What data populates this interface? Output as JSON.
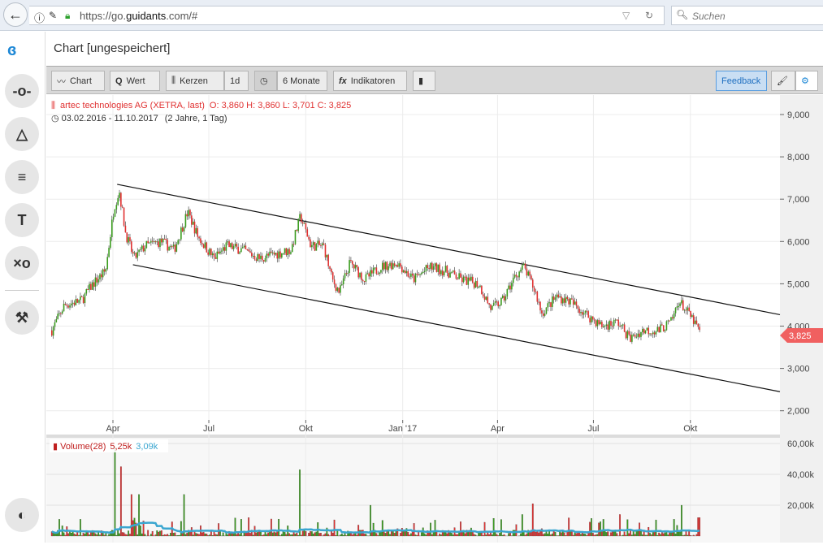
{
  "browser": {
    "url_prefix": "https://go.",
    "url_domain": "guidants",
    "url_suffix": ".com/#",
    "search_placeholder": "Suchen"
  },
  "page": {
    "title": "Chart [ungespeichert]"
  },
  "toolbar": {
    "chart": "Chart",
    "wert": "Wert",
    "kerzen": "Kerzen",
    "interval": "1d",
    "range": "6 Monate",
    "indikatoren": "Indikatoren",
    "feedback": "Feedback"
  },
  "colors": {
    "up": "#3a9c1e",
    "down": "#e03131",
    "accent": "#1e88d6",
    "volume_ma": "#3aa6d0",
    "last_price": "#f06060"
  },
  "chart_data": {
    "type": "candlestick",
    "instrument": "artec technologies AG (XETRA, last)",
    "ohlc_label": {
      "O": "3,860",
      "H": "3,860",
      "L": "3,701",
      "C": "3,825"
    },
    "ohlc_text": "O: 3,860  H: 3,860  L: 3,701  C: 3,825",
    "range_text": "03.02.2016 - 11.10.2017",
    "range_extra": "(2 Jahre, 1 Tag)",
    "last_price": "3,825",
    "y_ticks": [
      "9,000",
      "8,000",
      "7,000",
      "6,000",
      "5,000",
      "4,000",
      "3,000",
      "2,000"
    ],
    "ylim": [
      1800,
      9250
    ],
    "x_ticks": [
      {
        "label": "Apr",
        "date": "2016-04-01"
      },
      {
        "label": "Jul",
        "date": "2016-07-01"
      },
      {
        "label": "Okt",
        "date": "2016-10-01"
      },
      {
        "label": "Jan '17",
        "date": "2017-01-01"
      },
      {
        "label": "Apr",
        "date": "2017-04-01"
      },
      {
        "label": "Jul",
        "date": "2017-07-01"
      },
      {
        "label": "Okt",
        "date": "2017-10-01"
      }
    ],
    "closes": [
      [
        "2016-02-03",
        3.9
      ],
      [
        "2016-02-15",
        4.5
      ],
      [
        "2016-03-02",
        4.6
      ],
      [
        "2016-03-13",
        5.0
      ],
      [
        "2016-03-25",
        5.3
      ],
      [
        "2016-04-02",
        6.8
      ],
      [
        "2016-04-07",
        7.2
      ],
      [
        "2016-04-13",
        6.2
      ],
      [
        "2016-04-21",
        5.6
      ],
      [
        "2016-05-02",
        5.9
      ],
      [
        "2016-05-17",
        6.0
      ],
      [
        "2016-05-29",
        5.8
      ],
      [
        "2016-06-11",
        6.7
      ],
      [
        "2016-06-21",
        6.1
      ],
      [
        "2016-07-06",
        5.6
      ],
      [
        "2016-07-18",
        5.9
      ],
      [
        "2016-08-02",
        5.8
      ],
      [
        "2016-08-18",
        5.6
      ],
      [
        "2016-09-02",
        5.7
      ],
      [
        "2016-09-17",
        5.8
      ],
      [
        "2016-09-26",
        6.6
      ],
      [
        "2016-10-06",
        5.9
      ],
      [
        "2016-10-18",
        5.9
      ],
      [
        "2016-10-26",
        5.1
      ],
      [
        "2016-11-02",
        4.8
      ],
      [
        "2016-11-12",
        5.5
      ],
      [
        "2016-11-26",
        5.1
      ],
      [
        "2016-12-11",
        5.4
      ],
      [
        "2016-12-27",
        5.5
      ],
      [
        "2017-01-11",
        5.1
      ],
      [
        "2017-01-27",
        5.4
      ],
      [
        "2017-02-11",
        5.3
      ],
      [
        "2017-02-26",
        5.1
      ],
      [
        "2017-03-14",
        5.0
      ],
      [
        "2017-03-26",
        4.4
      ],
      [
        "2017-04-06",
        4.6
      ],
      [
        "2017-04-18",
        5.2
      ],
      [
        "2017-04-26",
        5.4
      ],
      [
        "2017-05-07",
        4.8
      ],
      [
        "2017-05-13",
        4.3
      ],
      [
        "2017-05-27",
        4.7
      ],
      [
        "2017-06-08",
        4.6
      ],
      [
        "2017-06-23",
        4.3
      ],
      [
        "2017-07-09",
        4.0
      ],
      [
        "2017-07-24",
        4.1
      ],
      [
        "2017-08-05",
        3.7
      ],
      [
        "2017-08-17",
        3.9
      ],
      [
        "2017-09-01",
        3.9
      ],
      [
        "2017-09-13",
        4.1
      ],
      [
        "2017-09-20",
        4.6
      ],
      [
        "2017-10-02",
        4.2
      ],
      [
        "2017-10-11",
        3.825
      ]
    ],
    "trendlines": [
      {
        "from": [
          "2016-04-05",
          7.35
        ],
        "to": [
          "2017-12-25",
          4.27
        ]
      },
      {
        "from": [
          "2016-04-20",
          5.45
        ],
        "to": [
          "2017-12-25",
          2.45
        ]
      }
    ],
    "volume": {
      "label": "Volume(28)",
      "value": "5,25k",
      "ma_value": "3,09k",
      "y_ticks": [
        "60,00k",
        "40,00k",
        "20,00k"
      ],
      "ylim": [
        0,
        60000
      ],
      "spikes": [
        [
          "2016-04-03",
          58000
        ],
        [
          "2016-04-08",
          45000
        ],
        [
          "2016-04-18",
          27000
        ],
        [
          "2016-04-26",
          27000
        ],
        [
          "2016-06-07",
          27000
        ],
        [
          "2016-09-25",
          43000
        ],
        [
          "2016-12-01",
          20000
        ],
        [
          "2017-05-04",
          21000
        ],
        [
          "2017-04-24",
          14000
        ],
        [
          "2017-07-26",
          14000
        ],
        [
          "2017-09-22",
          20000
        ],
        [
          "2017-10-09",
          12000
        ]
      ]
    }
  }
}
